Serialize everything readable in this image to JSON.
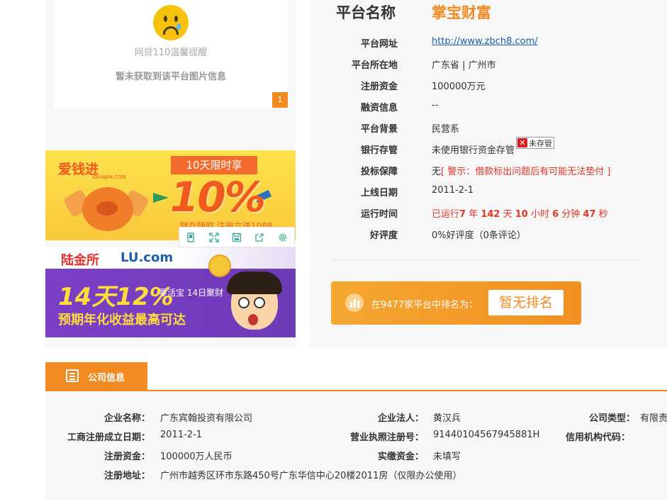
{
  "left": {
    "tip_title": "网贷110温馨提醒",
    "tip_message": "暂未获取到该平台图片信息",
    "page_badge": "1",
    "banner1": {
      "logo": "爱钱进",
      "logo_sub": "IQIANJIN.COM",
      "tag": "10天限时享",
      "percent": "10%",
      "subtitle": "随存随取 注册立送1088"
    },
    "banner2": {
      "logo": "陆金所",
      "logo_lu": "LU.com",
      "headline": "14天12%",
      "product": "零活宝 14日聚财",
      "slogan": "预期年化收益最高可达"
    },
    "toolbar_icons": [
      "phone-icon",
      "expand-icon",
      "save-icon",
      "share-icon",
      "settings-icon"
    ]
  },
  "platform": {
    "title_label": "平台名称",
    "title_value": "掌宝财富",
    "rows": [
      {
        "label": "平台网址",
        "value": "http://www.zbch8.com/"
      },
      {
        "label": "平台所在地",
        "value": "广东省 | 广州市"
      },
      {
        "label": "注册资金",
        "value": "100000万元"
      },
      {
        "label": "融资信息",
        "value": "--"
      },
      {
        "label": "平台背景",
        "value": "民营系"
      },
      {
        "label": "银行存管",
        "value": "未使用银行资金存管",
        "badge": "未存管"
      },
      {
        "label": "投标保障",
        "value": "无",
        "warning": "[ 警示：借款标出问题后有可能无法垫付 ]"
      },
      {
        "label": "上线日期",
        "value": "2011-2-1"
      },
      {
        "label": "运行时间",
        "prefix": "已运行",
        "years": "7",
        "y_unit": " 年 ",
        "days": "142",
        "d_unit": " 天 ",
        "hours": "10",
        "h_unit": " 小时 ",
        "minutes": "6",
        "m_unit": " 分钟 ",
        "seconds": "47",
        "s_unit": " 秒"
      },
      {
        "label": "好评度",
        "value": "0%好评度（0条评论）"
      }
    ],
    "rank_text": "在9477家平台中排名为：",
    "rank_button": "暂无排名"
  },
  "company": {
    "tab_label": "公司信息",
    "name_label": "企业名称：",
    "name_value": "广东宾翰投资有限公司",
    "legal_label": "企业法人：",
    "legal_value": "黄汉兵",
    "type_label": "公司类型：",
    "type_value": "有限责",
    "founded_label": "工商注册成立日期：",
    "founded_value": "2011-2-1",
    "license_label": "营业执照注册号：",
    "license_value": "91440104567945881H",
    "credit_label": "信用机构代码：",
    "capital_label": "注册资金：",
    "capital_value": "100000万人民币",
    "paid_label": "实缴资金：",
    "paid_value": "未填写",
    "address_label": "注册地址：",
    "address_value": "广州市越秀区环市东路450号广东华信中心20楼2011房（仅限办公使用）"
  },
  "colors": {
    "accent": "#f28a22",
    "warning": "#e3352a",
    "link": "#1a5dab"
  }
}
